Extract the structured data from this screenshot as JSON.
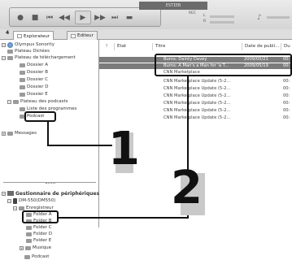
{
  "toolbar": {
    "lcd_text": "ESTIEB",
    "rec_label": "REC",
    "level_l": "L",
    "level_r": "R"
  },
  "tabs": [
    {
      "label": "Explorateur"
    },
    {
      "label": "Editeur"
    }
  ],
  "tree": {
    "root_label": "Olympus Sonority",
    "plateau_dictees": "Plateau Dictées",
    "plateau_telechargement": "Plateau de téléchargement",
    "dossiers": [
      "Dossier A",
      "Dossier B",
      "Dossier C",
      "Dossier D",
      "Dossier E"
    ],
    "plateau_podcasts": "Plateau des podcasts",
    "liste_programmes": "Liste des programmes",
    "podcast_1": "Podcast",
    "messages": "Messages",
    "gestionnaire": "Gestionnaire de périphériques",
    "device": "DM-550(DM550)",
    "enregistreur": "Enregistreur",
    "folders": [
      "Folder A",
      "Folder B",
      "Folder C",
      "Folder D",
      "Folder E"
    ],
    "musique": "Musique",
    "podcast_2": "Podcast"
  },
  "list": {
    "headers": {
      "flag": "!",
      "etat": "Etat",
      "titre": "Titre",
      "date": "Date de publi...",
      "dur": "Du"
    },
    "rows": [
      {
        "titre": "Burns: Dainty Davey",
        "date": "2009/05/21",
        "dur": "00:",
        "selected": true
      },
      {
        "titre": "Burns: A Man's a Man for 'a T...",
        "date": "2009/05/19",
        "dur": "00:",
        "selected": true
      },
      {
        "titre": "CNN Marketplace",
        "date": "",
        "dur": "",
        "selected": false
      },
      {
        "titre": "CNN Marketplace Update (5-2...",
        "date": "",
        "dur": "00:",
        "selected": false
      },
      {
        "titre": "CNN Marketplace Update (5-2...",
        "date": "",
        "dur": "00:",
        "selected": false
      },
      {
        "titre": "CNN Marketplace Update (5-2...",
        "date": "",
        "dur": "00:",
        "selected": false
      },
      {
        "titre": "CNN Marketplace Update (5-2...",
        "date": "",
        "dur": "00:",
        "selected": false
      },
      {
        "titre": "CNN Marketplace Update (5-2...",
        "date": "",
        "dur": "00:",
        "selected": false
      },
      {
        "titre": "CNN Marketplace Update (5-2...",
        "date": "",
        "dur": "00:",
        "selected": false
      }
    ]
  },
  "callouts": {
    "one": "1",
    "two": "2"
  }
}
